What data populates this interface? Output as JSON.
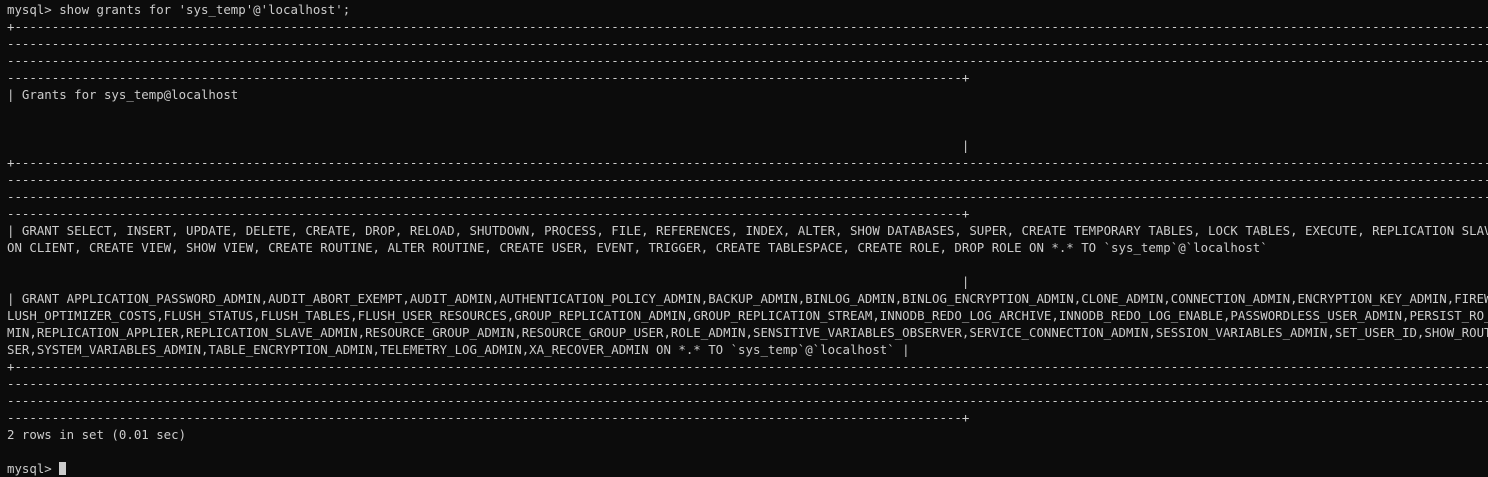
{
  "terminal": {
    "prompt": "mysql> ",
    "command": "show grants for 'sys_temp'@'localhost';",
    "border_top": "+----------------------------------------------------------------------------------------------------------------------------------------------------------------------------------------------------------------",
    "border_mid1": "--------------------------------------------------------------------------------------------------------------------------------------------------------------------------------------------------------------------",
    "border_mid2": "--------------------------------------------------------------------------------------------------------------------------------------------------------------------------------------------------------------------",
    "border_end": "--------------------------------------------------------------------------------------------------------------------------------+",
    "header_line": "| Grants for sys_temp@localhost",
    "header_pipe": "                                                                                                                                |",
    "row1_line1": "| GRANT SELECT, INSERT, UPDATE, DELETE, CREATE, DROP, RELOAD, SHUTDOWN, PROCESS, FILE, REFERENCES, INDEX, ALTER, SHOW DATABASES, SUPER, CREATE TEMPORARY TABLES, LOCK TABLES, EXECUTE, REPLICATION SLAVE, REPLICATI",
    "row1_line2": "ON CLIENT, CREATE VIEW, SHOW VIEW, CREATE ROUTINE, ALTER ROUTINE, CREATE USER, EVENT, TRIGGER, CREATE TABLESPACE, CREATE ROLE, DROP ROLE ON *.* TO `sys_temp`@`localhost`",
    "row1_pipe": "                                                                                                                                |",
    "row2_line1": "| GRANT APPLICATION_PASSWORD_ADMIN,AUDIT_ABORT_EXEMPT,AUDIT_ADMIN,AUTHENTICATION_POLICY_ADMIN,BACKUP_ADMIN,BINLOG_ADMIN,BINLOG_ENCRYPTION_ADMIN,CLONE_ADMIN,CONNECTION_ADMIN,ENCRYPTION_KEY_ADMIN,FIREWALL_EXEMPT,F",
    "row2_line2": "LUSH_OPTIMIZER_COSTS,FLUSH_STATUS,FLUSH_TABLES,FLUSH_USER_RESOURCES,GROUP_REPLICATION_ADMIN,GROUP_REPLICATION_STREAM,INNODB_REDO_LOG_ARCHIVE,INNODB_REDO_LOG_ENABLE,PASSWORDLESS_USER_ADMIN,PERSIST_RO_VARIABLES_AD",
    "row2_line3": "MIN,REPLICATION_APPLIER,REPLICATION_SLAVE_ADMIN,RESOURCE_GROUP_ADMIN,RESOURCE_GROUP_USER,ROLE_ADMIN,SENSITIVE_VARIABLES_OBSERVER,SERVICE_CONNECTION_ADMIN,SESSION_VARIABLES_ADMIN,SET_USER_ID,SHOW_ROUTINE,SYSTEM_U",
    "row2_line4": "SER,SYSTEM_VARIABLES_ADMIN,TABLE_ENCRYPTION_ADMIN,TELEMETRY_LOG_ADMIN,XA_RECOVER_ADMIN ON *.* TO `sys_temp`@`localhost` |",
    "summary": "2 rows in set (0.01 sec)",
    "cursor_icon": "block-cursor"
  }
}
